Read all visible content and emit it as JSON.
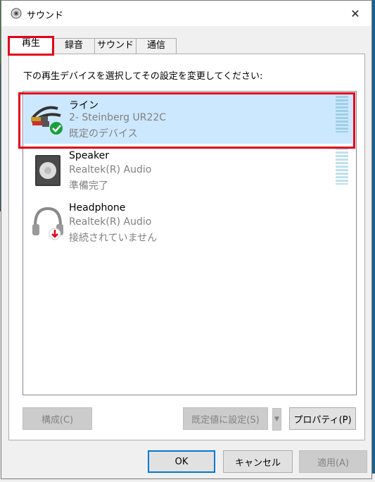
{
  "window": {
    "title": "サウンド",
    "close_glyph": "✕"
  },
  "tabs": [
    {
      "label": "再生",
      "active": true
    },
    {
      "label": "録音",
      "active": false
    },
    {
      "label": "サウンド",
      "active": false
    },
    {
      "label": "通信",
      "active": false
    }
  ],
  "panel": {
    "instruction": "下の再生デバイスを選択してその設定を変更してください:",
    "devices": [
      {
        "name": "ライン",
        "description": "2- Steinberg UR22C",
        "status": "既定のデバイス",
        "icon": "rca-cable-icon",
        "badge": "check-badge-icon",
        "selected": true
      },
      {
        "name": "Speaker",
        "description": "Realtek(R) Audio",
        "status": "準備完了",
        "icon": "speaker-icon",
        "selected": false
      },
      {
        "name": "Headphone",
        "description": "Realtek(R) Audio",
        "status": "接続されていません",
        "icon": "headphone-icon",
        "badge": "down-arrow-badge-icon",
        "selected": false
      }
    ],
    "buttons": {
      "configure": "構成(C)",
      "set_default": "既定値に設定(S)",
      "properties": "プロパティ(P)"
    }
  },
  "footer": {
    "ok": "OK",
    "cancel": "キャンセル",
    "apply": "適用(A)"
  },
  "colors": {
    "highlight": "#e3001b",
    "selection": "#cce8ff",
    "accent": "#0078d7"
  }
}
